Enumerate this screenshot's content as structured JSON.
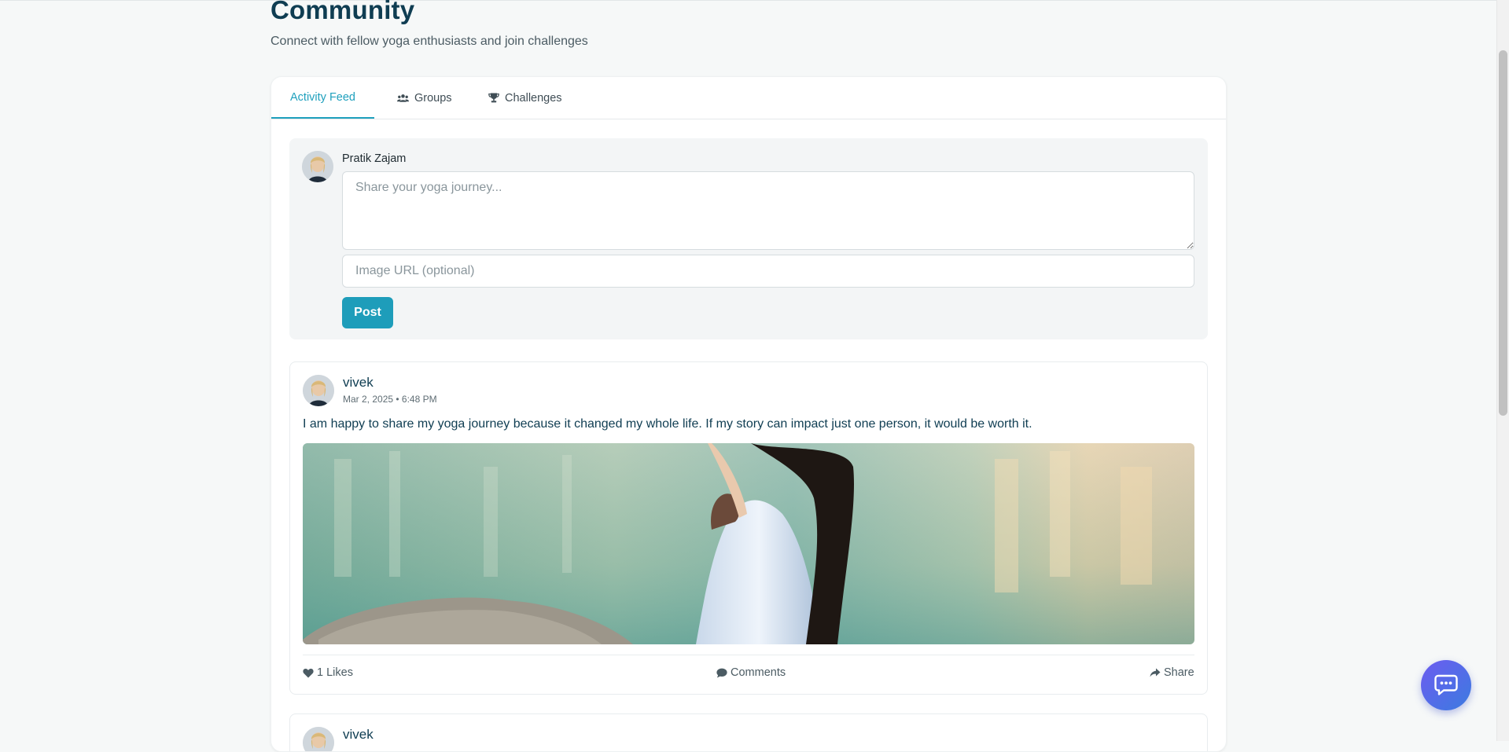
{
  "header": {
    "title": "Community",
    "subtitle": "Connect with fellow yoga enthusiasts and join challenges"
  },
  "tabs": [
    {
      "label": "Activity Feed",
      "active": true,
      "icon": ""
    },
    {
      "label": "Groups",
      "active": false,
      "icon": "users-icon"
    },
    {
      "label": "Challenges",
      "active": false,
      "icon": "trophy-icon"
    }
  ],
  "composer": {
    "user_name": "Pratik Zajam",
    "text_placeholder": "Share your yoga journey...",
    "image_url_placeholder": "Image URL (optional)",
    "post_label": "Post"
  },
  "posts": [
    {
      "author": "vivek",
      "timestamp": "Mar 2, 2025 • 6:48 PM",
      "text": "I am happy to share my yoga journey because it changed my whole life. If my story can impact just one person, it would be worth it.",
      "likes_label": "1 Likes",
      "comments_label": "Comments",
      "share_label": "Share"
    },
    {
      "author": "vivek"
    }
  ],
  "colors": {
    "accent": "#1e9dba",
    "heading": "#0f3d52",
    "chat_gradient_start": "#6d5cf0",
    "chat_gradient_end": "#3b7be0"
  },
  "icons": {
    "likes": "heart-icon",
    "comments": "comment-icon",
    "share": "share-icon",
    "chat": "chat-bubble-icon"
  }
}
